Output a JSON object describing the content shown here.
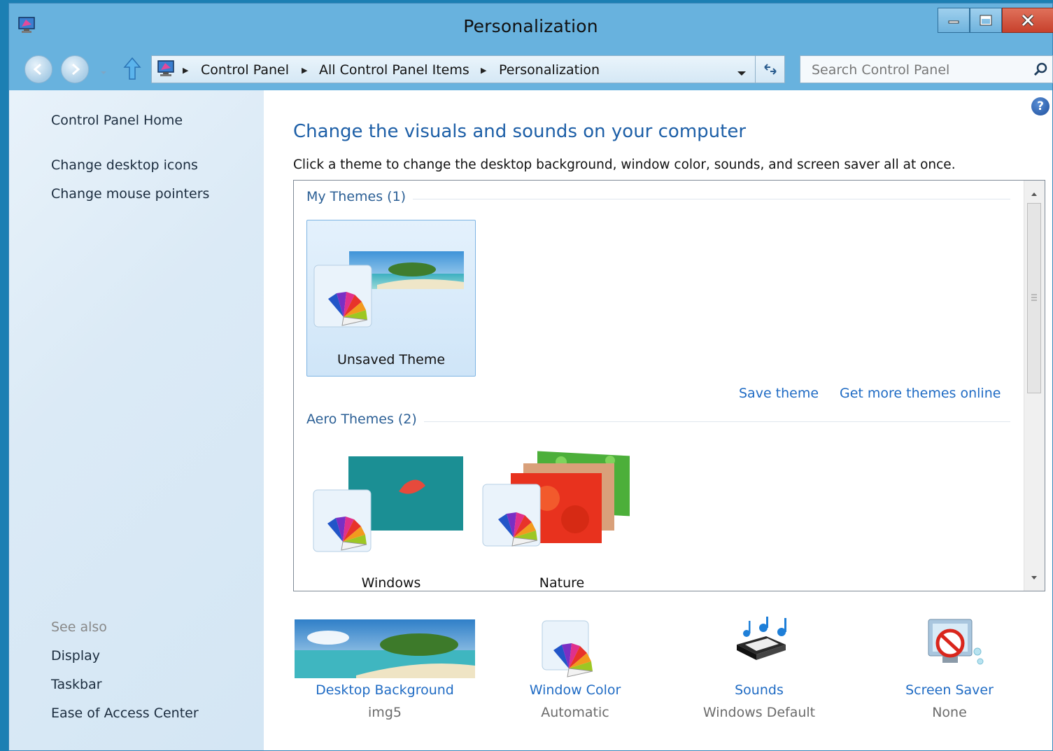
{
  "window": {
    "title": "Personalization"
  },
  "controls": {
    "minimize": "minimize",
    "maximize": "maximize",
    "close": "close"
  },
  "address": {
    "crumbs": [
      "Control Panel",
      "All Control Panel Items",
      "Personalization"
    ]
  },
  "search": {
    "placeholder": "Search Control Panel"
  },
  "sidebar": {
    "home": "Control Panel Home",
    "links": [
      "Change desktop icons",
      "Change mouse pointers"
    ],
    "see_also_title": "See also",
    "see_also": [
      "Display",
      "Taskbar",
      "Ease of Access Center"
    ]
  },
  "main": {
    "heading": "Change the visuals and sounds on your computer",
    "subtext": "Click a theme to change the desktop background, window color, sounds, and screen saver all at once.",
    "my_themes": {
      "title": "My Themes (1)",
      "items": [
        "Unsaved Theme"
      ]
    },
    "links": {
      "save": "Save theme",
      "more": "Get more themes online"
    },
    "aero_themes": {
      "title": "Aero Themes (2)",
      "items": [
        "Windows",
        "Nature"
      ]
    }
  },
  "bottom": [
    {
      "title": "Desktop Background",
      "value": "img5"
    },
    {
      "title": "Window Color",
      "value": "Automatic"
    },
    {
      "title": "Sounds",
      "value": "Windows Default"
    },
    {
      "title": "Screen Saver",
      "value": "None"
    }
  ],
  "colors": {
    "titlebar": "#68b2de",
    "link": "#1f6bc4",
    "heading": "#1d5fa7",
    "close": "#c7412c"
  }
}
